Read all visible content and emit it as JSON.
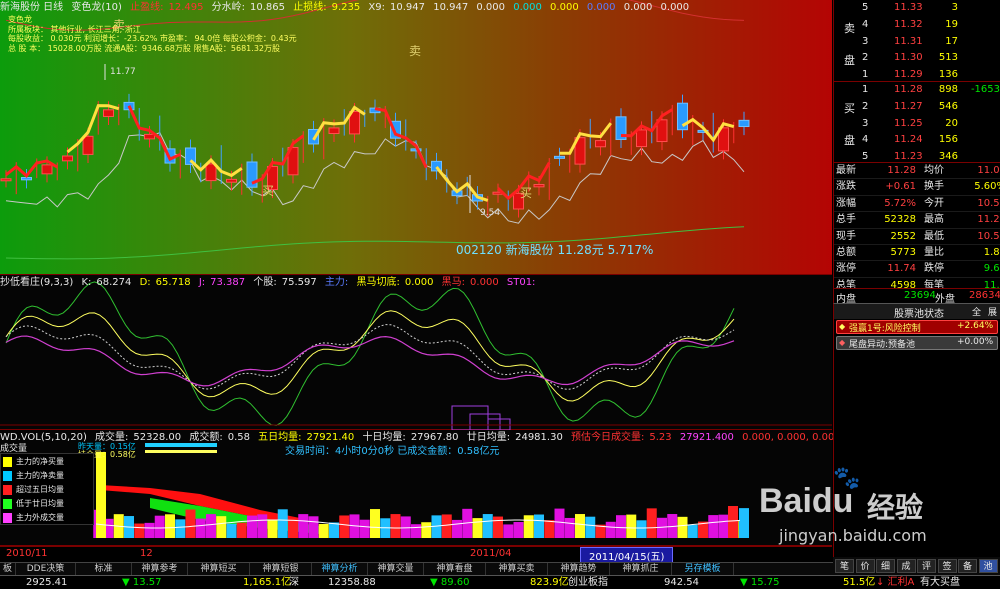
{
  "main_panel": {
    "title": "新海股份 日线",
    "indicator": "变色龙(10)",
    "stop_profit_label": "止盈线:",
    "stop_profit": "12.495",
    "watershed_label": "分水岭:",
    "watershed": "10.865",
    "stop_loss_label": "止损线:",
    "stop_loss": "9.235",
    "x9_label": "X9:",
    "x9": "10.947",
    "v1": "10.947",
    "v2": "0.000",
    "v3": "0.000",
    "v4": "0.000",
    "v5": "0.000",
    "v6": "0.000",
    "v7": "0.000",
    "info": {
      "name": "变色龙",
      "industry": "所属板块：  其他行业, 长江三角, 浙江",
      "eps": "每股收益：  0.030元     利润增长：-23.62%     市盈率：  94.0倍   每股公积金：0.43元",
      "shares": "总 股 本：  15028.00万股   流通A股：9346.68万股   限售A股：5681.32万股"
    },
    "labels": {
      "sell1": "卖",
      "sell2": "卖",
      "buy1": "买",
      "buy2": "买",
      "high": "11.77",
      "low": "9.54"
    },
    "stock_caption": "002120  新海股份  11.28元  5.717%"
  },
  "kdj_panel": {
    "title": "抄低看庄(9,3,3)",
    "k_label": "K:",
    "k": "68.274",
    "d_label": "D:",
    "d": "65.718",
    "j_label": "J:",
    "j": "73.387",
    "stock_label": "个股:",
    "stock": "75.597",
    "big_label": "主力:",
    "horse_label": "黑马切底:",
    "horse": "0.000",
    "black_label": "黑马:",
    "black": "0.000",
    "st_label": "ST01:"
  },
  "vol_panel": {
    "title": "WD.VOL(5,10,20)",
    "vol_label": "成交量:",
    "vol": "52328.00",
    "amt_label": "成交额:",
    "amt": "0.58",
    "ma5_label": "五日均量:",
    "ma5": "27921.40",
    "ma10_label": "十日均量:",
    "ma10": "27967.80",
    "ma20_label": "廿日均量:",
    "ma20": "24981.30",
    "pred_label": "预估今日成交量:",
    "pred": "5.23",
    "extra": "27921.400",
    "zeros": "0.000, 0.000, 0.000, 0.000, 0.000",
    "prev_label": "昨天量：0.15亿",
    "hold_label": "持仓量：0.58亿",
    "trade_time": "交易时间：4小时0分0秒    已成交金额：0.58亿元",
    "legend_title": "成交量",
    "legend": [
      "主力的净买量",
      "主力的净卖量",
      "超过五日均量",
      "低于廿日均量",
      "主力外成交量"
    ],
    "dates": [
      "2010/11",
      "12",
      "2011/04",
      "2011/04/15(五)"
    ]
  },
  "order_book": {
    "sell_label": "卖",
    "sell_label2": "盘",
    "buy_label": "买",
    "buy_label2": "盘",
    "asks": [
      {
        "level": "5",
        "price": "11.33",
        "vol": "3"
      },
      {
        "level": "4",
        "price": "11.32",
        "vol": "19"
      },
      {
        "level": "3",
        "price": "11.31",
        "vol": "17"
      },
      {
        "level": "2",
        "price": "11.30",
        "vol": "513"
      },
      {
        "level": "1",
        "price": "11.29",
        "vol": "136"
      }
    ],
    "bids": [
      {
        "level": "1",
        "price": "11.28",
        "vol": "898",
        "extra": "-1653"
      },
      {
        "level": "2",
        "price": "11.27",
        "vol": "546",
        "extra": ""
      },
      {
        "level": "3",
        "price": "11.25",
        "vol": "20",
        "extra": ""
      },
      {
        "level": "4",
        "price": "11.24",
        "vol": "156",
        "extra": ""
      },
      {
        "level": "5",
        "price": "11.23",
        "vol": "346",
        "extra": ""
      }
    ]
  },
  "quote": [
    {
      "l1": "最新",
      "v1": "11.28",
      "l2": "均价",
      "v2": "11.03"
    },
    {
      "l1": "涨跌",
      "v1": "+0.61",
      "l2": "换手",
      "v2": "5.60%"
    },
    {
      "l1": "涨幅",
      "v1": "5.72%",
      "l2": "今开",
      "v2": "10.58"
    },
    {
      "l1": "总手",
      "v1": "52328",
      "l2": "最高",
      "v2": "11.28"
    },
    {
      "l1": "现手",
      "v1": "2552",
      "l2": "最低",
      "v2": "10.58"
    },
    {
      "l1": "总额",
      "v1": "5773",
      "l2": "量比",
      "v2": "1.82"
    },
    {
      "l1": "涨停",
      "v1": "11.74",
      "l2": "跌停",
      "v2": "9.60"
    },
    {
      "l1": "总笔",
      "v1": "4598",
      "l2": "每笔",
      "v2": "11.4"
    }
  ],
  "inout": {
    "in_label": "内盘",
    "in_val": "23694",
    "out_label": "外盘",
    "out_val": "28634"
  },
  "pool": {
    "title": "股票池状态",
    "btn_all": "全",
    "btn_expand": "展",
    "items": [
      {
        "name": "强赢1号:风险控制",
        "value": "+2.64%"
      },
      {
        "name": "尾盘异动:预备池",
        "value": "+0.00%"
      }
    ]
  },
  "tabs": [
    "板",
    "DDE决策",
    "标准",
    "神算参考",
    "神算短买",
    "神算短银",
    "神算分析",
    "神算交量",
    "神算看盘",
    "神算买卖",
    "神算趋势",
    "神算抓庄",
    "另存模板"
  ],
  "status": {
    "idx1": "2925.41",
    "chg1": "▼ 13.57",
    "amt1": "1,165.1亿",
    "mkt": "深",
    "idx2": "12358.88",
    "chg2": "▼ 89.60",
    "amt2": "823.9亿",
    "name3": "创业板指",
    "idx3": "942.54",
    "chg3": "▼ 15.75",
    "amt3": "51.5亿",
    "name4": "↓ 汇利A",
    "tail": "有大买盘"
  },
  "right_tabs": [
    "笔",
    "价",
    "细",
    "成",
    "评",
    "签",
    "备",
    "池"
  ],
  "watermark": {
    "brand": "Baidu",
    "sub": "经验",
    "url": "jingyan.baidu.com"
  }
}
